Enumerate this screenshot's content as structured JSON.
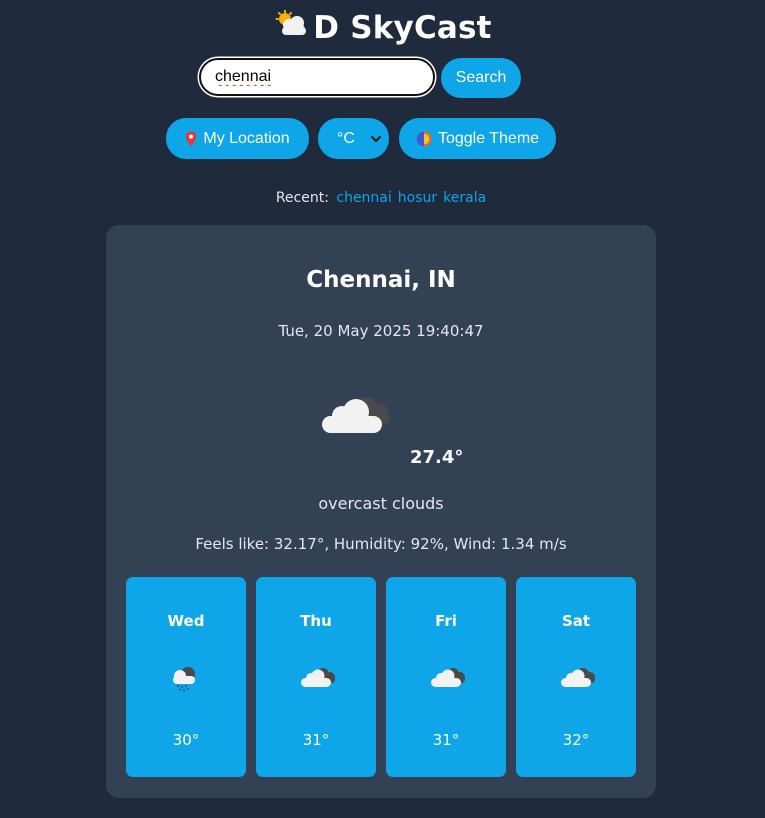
{
  "app": {
    "title": "D SkyCast",
    "logo_icon": "sun-behind-cloud-icon"
  },
  "search": {
    "value": "chennai",
    "placeholder": "",
    "button_label": "Search"
  },
  "controls": {
    "location_label": "My Location",
    "location_icon": "pin-icon",
    "unit_value": "°C",
    "theme_label": "Toggle Theme",
    "theme_icon": "half-moon-icon"
  },
  "recent": {
    "label": "Recent:",
    "items": [
      "chennai",
      "hosur",
      "kerala"
    ]
  },
  "current": {
    "city": "Chennai, IN",
    "datetime": "Tue, 20 May 2025 19:40:47",
    "icon": "overcast-clouds-icon",
    "temp": "27.4°",
    "description": "overcast clouds",
    "details": "Feels like: 32.17°, Humidity: 92%, Wind: 1.34 m/s"
  },
  "forecast": [
    {
      "day": "Wed",
      "icon": "rain-cloud-icon",
      "temp": "30°"
    },
    {
      "day": "Thu",
      "icon": "cloud-icon",
      "temp": "31°"
    },
    {
      "day": "Fri",
      "icon": "cloud-icon",
      "temp": "31°"
    },
    {
      "day": "Sat",
      "icon": "cloud-icon",
      "temp": "32°"
    }
  ],
  "colors": {
    "background": "#1f2a3c",
    "card": "#334155",
    "accent": "#0ea5e9"
  }
}
